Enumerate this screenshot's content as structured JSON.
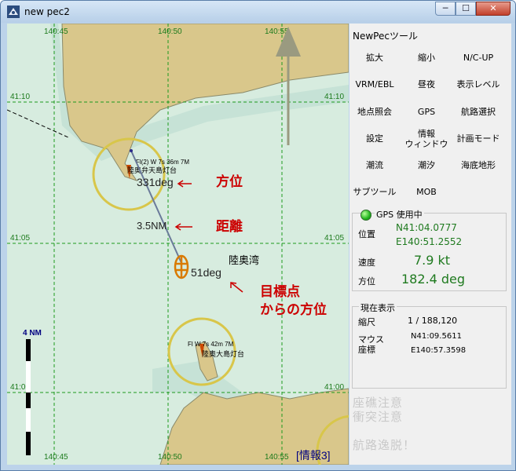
{
  "window": {
    "title": "new pec2",
    "min_glyph": "─",
    "max_glyph": "☐",
    "close_glyph": "✕"
  },
  "map": {
    "grid_lon_top": [
      "140:45",
      "140:50",
      "140:55"
    ],
    "grid_lon_bottom": [
      "140:45",
      "140:50",
      "140:55"
    ],
    "grid_lat_left": [
      "41:10",
      "41:05",
      "41:00"
    ],
    "grid_lat_right": [
      "41:10",
      "41:05",
      "41:00"
    ],
    "scale_label": "4 NM",
    "lighthouse1_desc": "Fl(2) W 7s 36m 7M",
    "lighthouse1_name": "陸奥弁天島灯台",
    "lighthouse2_desc": "Fl W 7s 42m 7M",
    "lighthouse2_name": "陸奥大島灯台",
    "bearing_value": "331deg",
    "distance_value": "3.5NM",
    "bearing_from_target_value": "51deg",
    "bay_name": "陸奥湾",
    "annotation_bearing": "方位",
    "annotation_distance": "距離",
    "annotation_target_line1": "目標点",
    "annotation_target_line2": "からの方位",
    "info_label": "[情報3]",
    "colors": {
      "sea": "#d7ecdf",
      "land": "#d9c78b",
      "grid": "#1c9a1c",
      "annotation": "#cc0000"
    }
  },
  "panel": {
    "title": "NewPecツール",
    "buttons": [
      {
        "label": "拡大"
      },
      {
        "label": "縮小"
      },
      {
        "label": "N/C-UP"
      },
      {
        "label": "VRM/EBL"
      },
      {
        "label": "昼夜"
      },
      {
        "label": "表示レベル"
      },
      {
        "label": "地点照会"
      },
      {
        "label": "GPS"
      },
      {
        "label": "航路選択"
      },
      {
        "label": "設定"
      },
      {
        "label": "情報ウィンドウ",
        "line1": "情報",
        "line2": "ウィンドウ"
      },
      {
        "label": "計画モード"
      },
      {
        "label": "潮流"
      },
      {
        "label": "潮汐"
      },
      {
        "label": "海底地形"
      },
      {
        "label": "サブツール"
      },
      {
        "label": "MOB"
      }
    ],
    "gps": {
      "status": "GPS 使用中",
      "position_label": "位置",
      "lat": "N41:04.0777",
      "lon": "E140:51.2552",
      "speed_label": "速度",
      "speed": "7.9 kt",
      "heading_label": "方位",
      "heading": "182.4 deg"
    },
    "current": {
      "group_label": "現在表示",
      "scale_label": "縮尺",
      "scale": "1 / 188,120",
      "mouse_label_1": "マウス",
      "mouse_label_2": "座標",
      "mouse_lat": "N41:09.5611",
      "mouse_lon": "E140:57.3598"
    },
    "warnings": {
      "grounding": "座礁注意",
      "collision": "衝突注意",
      "off_route": "航路逸脱！"
    }
  }
}
